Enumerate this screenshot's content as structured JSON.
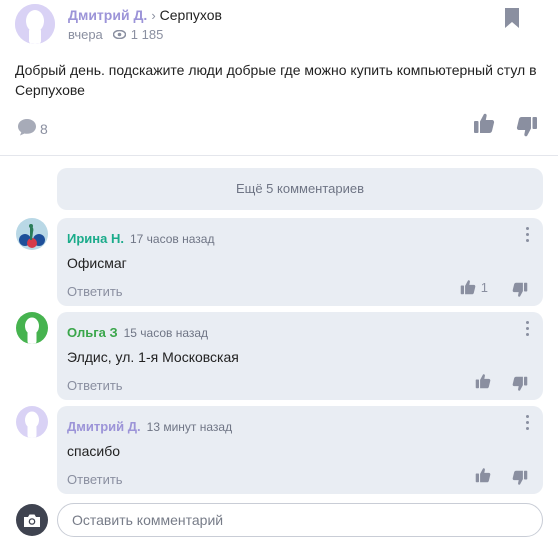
{
  "post": {
    "author": "Дмитрий Д.",
    "chevron": "›",
    "location": "Серпухов",
    "time": "вчера",
    "views": "1 185",
    "text": "Добрый день. подскажите люди добрые где можно купить компьютерный стул в Серпухове",
    "comments_count": "8",
    "author_color": "#9c94d8",
    "icons": [
      "bookmark-icon",
      "eye-icon",
      "comment-bubble-icon",
      "thumbs-up-icon",
      "thumbs-down-icon"
    ]
  },
  "more_comments": {
    "label": "Ещё 5 комментариев"
  },
  "comments": [
    {
      "name": "Ирина Н.",
      "time": "17 часов назад",
      "text": "Офисмаг",
      "reply": "Ответить",
      "likes": "1",
      "name_color": "#1aab8a"
    },
    {
      "name": "Ольга З",
      "time": "15 часов назад",
      "text": "Элдис, ул. 1-я Московская",
      "reply": "Ответить",
      "likes": "",
      "name_color": "#3aa64a"
    },
    {
      "name": "Дмитрий Д.",
      "time": "13 минут назад",
      "text": "спасибо",
      "reply": "Ответить",
      "likes": "",
      "name_color": "#9c94d8"
    }
  ],
  "composer": {
    "placeholder": "Оставить комментарий",
    "icon": "camera-icon"
  }
}
